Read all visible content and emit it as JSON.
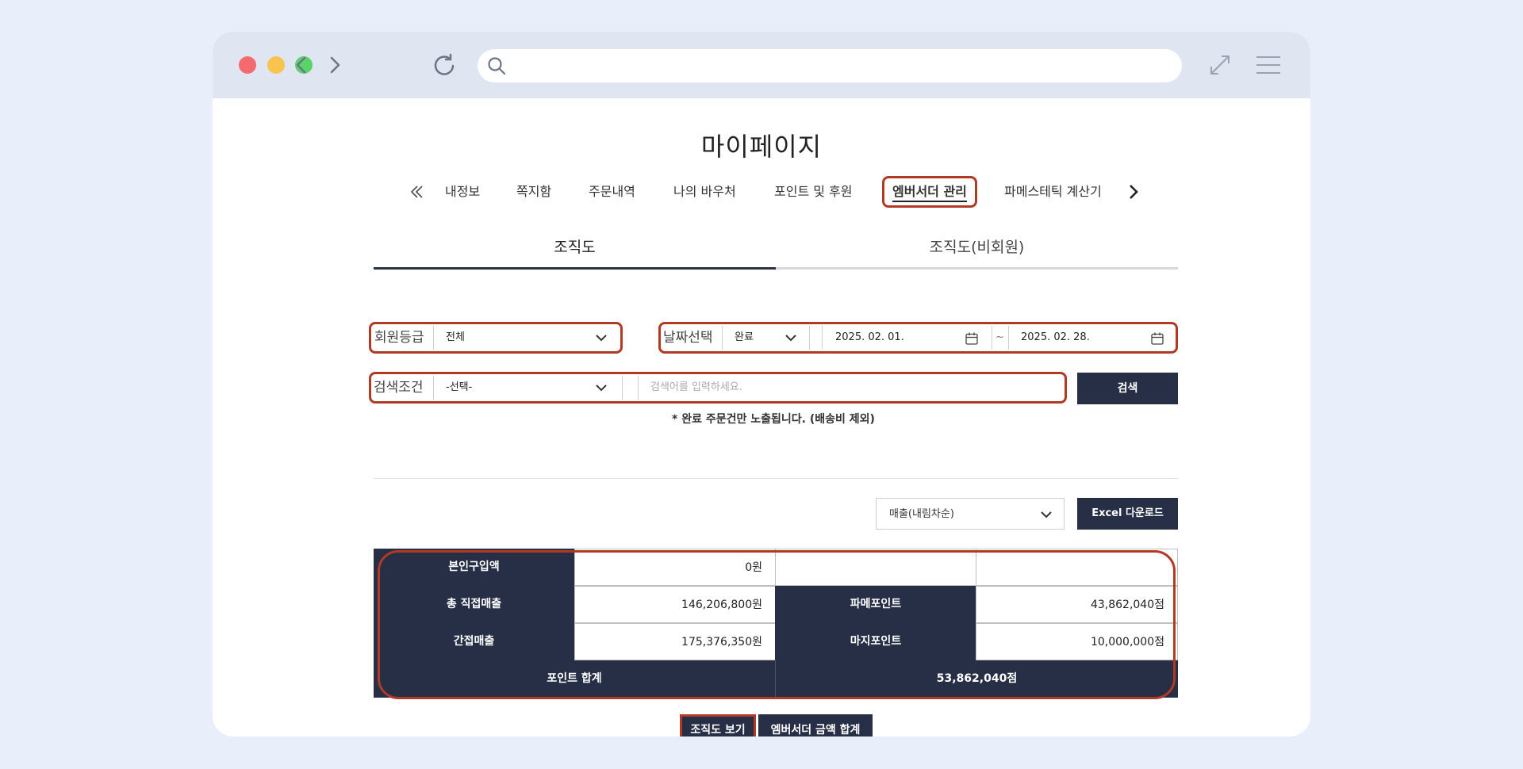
{
  "page": {
    "title": "마이페이지"
  },
  "nav": {
    "items": [
      {
        "label": "내정보"
      },
      {
        "label": "쪽지함"
      },
      {
        "label": "주문내역"
      },
      {
        "label": "나의 바우처"
      },
      {
        "label": "포인트 및 후원"
      },
      {
        "label": "엠버서더 관리"
      },
      {
        "label": "파메스테틱 계산기"
      }
    ],
    "active_index": 5
  },
  "tabs": [
    {
      "label": "조직도",
      "active": true
    },
    {
      "label": "조직도(비회원)",
      "active": false
    }
  ],
  "filters": {
    "grade_label": "회원등급",
    "grade_value": "전체",
    "date_label": "날짜선택",
    "date_status": "완료",
    "date_from": "2025. 02. 01.",
    "date_sep": "~",
    "date_to": "2025. 02. 28.",
    "search_label": "검색조건",
    "search_condition": "-선택-",
    "search_placeholder": "검색어를 입력하세요.",
    "search_button": "검색"
  },
  "note": "* 완료 주문건만 노출됩니다. (배송비 제외)",
  "sort": {
    "selected": "매출(내림차순)",
    "excel_button": "Excel 다운로드"
  },
  "summary": {
    "own_purchase_label": "본인구입액",
    "own_purchase_value": "0원",
    "direct_sales_label": "총 직접매출",
    "direct_sales_value": "146,206,800원",
    "pame_point_label": "파메포인트",
    "pame_point_value": "43,862,040점",
    "indirect_sales_label": "간접매출",
    "indirect_sales_value": "175,376,350원",
    "maji_point_label": "마지포인트",
    "maji_point_value": "10,000,000점",
    "point_total_label": "포인트 합계",
    "point_total_value": "53,862,040점"
  },
  "actions": {
    "org_view": "조직도 보기",
    "ambassador_total": "엠버서더 금액 합계"
  },
  "colors": {
    "dark": "#262f45",
    "highlight": "#b13a25",
    "titlebar": "#dfe6f1",
    "background": "#e8effb"
  }
}
